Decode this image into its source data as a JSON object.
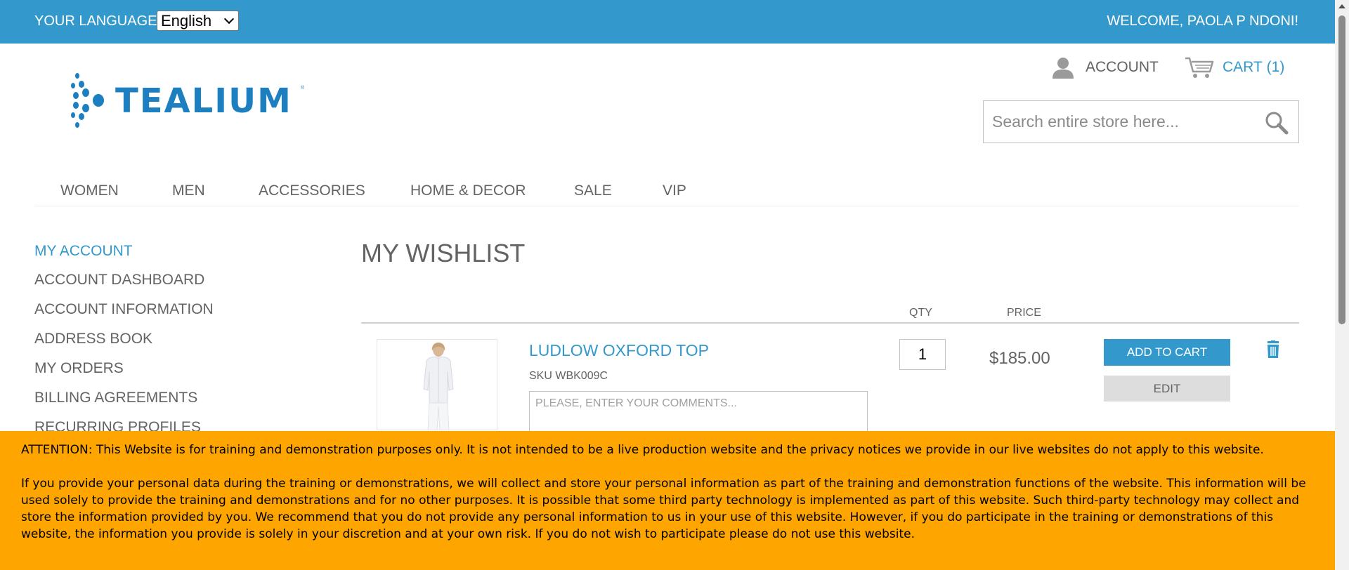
{
  "topbar": {
    "language_label": "YOUR LANGUAGE:",
    "language_selected": "English",
    "welcome": "WELCOME, PAOLA P NDONI!"
  },
  "header": {
    "logo_text": "TEALIUM",
    "logo_tm": "®",
    "account_label": "ACCOUNT",
    "cart_label": "CART",
    "cart_count": "(1)",
    "search_placeholder": "Search entire store here..."
  },
  "nav": {
    "items": [
      "WOMEN",
      "MEN",
      "ACCESSORIES",
      "HOME & DECOR",
      "SALE",
      "VIP"
    ]
  },
  "sidebar": {
    "title": "MY ACCOUNT",
    "items": [
      "ACCOUNT DASHBOARD",
      "ACCOUNT INFORMATION",
      "ADDRESS BOOK",
      "MY ORDERS",
      "BILLING AGREEMENTS",
      "RECURRING PROFILES"
    ]
  },
  "main": {
    "title": "MY WISHLIST",
    "columns": {
      "qty": "QTY",
      "price": "PRICE"
    },
    "item": {
      "name": "LUDLOW OXFORD TOP",
      "sku": "SKU WBK009C",
      "comment_placeholder": "PLEASE, ENTER YOUR COMMENTS...",
      "qty": "1",
      "price": "$185.00",
      "add_to_cart": "ADD TO CART",
      "edit": "EDIT"
    }
  },
  "notice": {
    "paragraph1": "ATTENTION: This Website is for training and demonstration purposes only. It is not intended to be a live production website and the privacy notices we provide in our live websites do not apply to this website.",
    "paragraph2": "If you provide your personal data during the training or demonstrations, we will collect and store your personal information as part of the training and demonstration functions of the website. This information will be used solely to provide the training and demonstrations and for no other purposes. It is possible that some third party technology is implemented as part of this website. Such third-party technology may collect and store the information provided by you. We recommend that you do not provide any personal information to us in your use of this website. However, if you do participate in the training or demonstrations of this website, the information you provide is solely in your discretion and at your own risk. If you do not wish to participate please do not use this website."
  },
  "colors": {
    "brand_blue": "#3399cc",
    "notice_orange": "#ffa500",
    "text_gray": "#636363"
  },
  "icons": {
    "account": "user-icon",
    "cart": "cart-icon",
    "search": "search-icon",
    "trash": "trash-icon",
    "logo_mark": "dots-logo-icon"
  }
}
